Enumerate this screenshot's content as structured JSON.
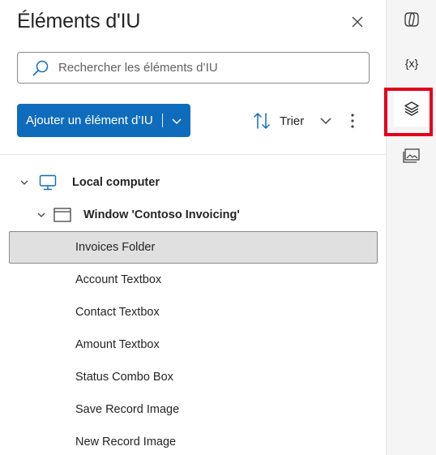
{
  "panel": {
    "title": "Éléments d'IU",
    "close_icon": "close-icon"
  },
  "search": {
    "placeholder": "Rechercher les éléments d’IU",
    "value": "",
    "icon": "search-icon"
  },
  "toolbar": {
    "add_label": "Ajouter un élément d’IU",
    "sort_label": "Trier",
    "more_icon": "more-vertical-icon"
  },
  "tree": {
    "computer": {
      "label": "Local computer",
      "icon": "computer-icon",
      "expanded": true
    },
    "window": {
      "label": "Window 'Contoso Invoicing'",
      "icon": "window-icon",
      "expanded": true
    },
    "elements": [
      {
        "label": "Invoices Folder",
        "selected": true
      },
      {
        "label": "Account Textbox",
        "selected": false
      },
      {
        "label": "Contact Textbox",
        "selected": false
      },
      {
        "label": "Amount Textbox",
        "selected": false
      },
      {
        "label": "Status Combo Box",
        "selected": false
      },
      {
        "label": "Save Record Image",
        "selected": false
      },
      {
        "label": "New Record Image",
        "selected": false
      }
    ]
  },
  "rail": {
    "items": [
      {
        "icon": "copilot-icon",
        "active": false
      },
      {
        "icon": "variables-icon",
        "text": "{x}",
        "active": false
      },
      {
        "icon": "ui-elements-layers-icon",
        "active": true
      },
      {
        "icon": "images-icon",
        "active": false
      }
    ],
    "highlight_color": "#e3001b"
  },
  "colors": {
    "accent": "#0f6cbd",
    "selected_row": "#e0e0e0",
    "rail_bg": "#f5f5f5"
  }
}
